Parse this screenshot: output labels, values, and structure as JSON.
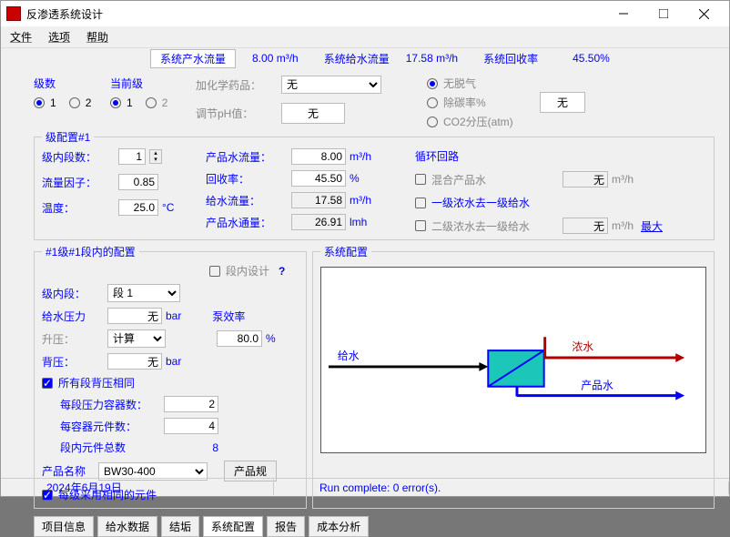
{
  "window": {
    "title": "反渗透系统设计"
  },
  "menu": {
    "file": "文件",
    "options": "选项",
    "help": "帮助"
  },
  "topstats": {
    "perm_flow_l": "系统产水流量",
    "perm_flow_v": "8.00 m³/h",
    "feed_flow_l": "系统给水流量",
    "feed_flow_v": "17.58 m³/h",
    "recovery_l": "系统回收率",
    "recovery_v": "45.50%"
  },
  "passes": {
    "label": "级数",
    "opt1": "1",
    "opt2": "2",
    "current_label": "当前级",
    "cur1": "1",
    "cur2": "2"
  },
  "chem": {
    "add_l": "加化学药品：",
    "add_v": "无",
    "ph_l": "调节pH值：",
    "ph_v": "无",
    "degas_l": "无脱气",
    "decarb_l": "除碳率%",
    "co2_l": "CO2分压(atm)",
    "btn": "无"
  },
  "stagecfg_legend": "级配置#1",
  "stagecfg": {
    "stages_l": "级内段数：",
    "stages_v": "1",
    "ff_l": "流量因子：",
    "ff_v": "0.85",
    "temp_l": "温度：",
    "temp_v": "25.0",
    "temp_u": "°C",
    "perm_l": "产品水流量：",
    "perm_v": "8.00",
    "perm_u": "m³/h",
    "rec_l": "回收率：",
    "rec_v": "45.50",
    "rec_u": "%",
    "feed_l": "给水流量：",
    "feed_v": "17.58",
    "feed_u": "m³/h",
    "flux_l": "产品水通量：",
    "flux_v": "26.91",
    "flux_u": "lmh"
  },
  "loop": {
    "legend": "循环回路",
    "mix_l": "混合产品水",
    "mix_v": "无",
    "mix_u": "m³/h",
    "c1_l": "一级浓水去一级给水",
    "c2_l": "二级浓水去一级给水",
    "c2_v": "无",
    "c2_u": "m³/h",
    "max": "最大"
  },
  "seg": {
    "legend": "#1级#1段内的配置",
    "stage_l": "级内段：",
    "stage_v": "段 1",
    "design_l": "段内设计",
    "feedp_l": "给水压力",
    "feedp_v": "无",
    "feedp_u": "bar",
    "boost_l": "升压：",
    "boost_v": "计算",
    "pump_l": "泵效率",
    "pump_v": "80.0",
    "pump_u": "%",
    "back_l": "背压：",
    "back_v": "无",
    "back_u": "bar",
    "same_back_l": "所有段背压相同",
    "pv_l": "每段压力容器数：",
    "pv_v": "2",
    "epv_l": "每容器元件数：",
    "epv_v": "4",
    "tot_l": "段内元件总数",
    "tot_v": "8",
    "prod_l": "产品名称",
    "prod_v": "BW30-400",
    "prod_btn": "产品规",
    "same_el_l": "每级采用相同的元件"
  },
  "syscfg_legend": "系统配置",
  "diagram": {
    "feed": "给水",
    "conc": "浓水",
    "perm": "产品水"
  },
  "tabs": {
    "t1": "项目信息",
    "t2": "给水数据",
    "t3": "结垢",
    "t4": "系统配置",
    "t5": "报告",
    "t6": "成本分析"
  },
  "status": {
    "date": "2024年6月19日",
    "run": "Run complete: 0 error(s)."
  }
}
